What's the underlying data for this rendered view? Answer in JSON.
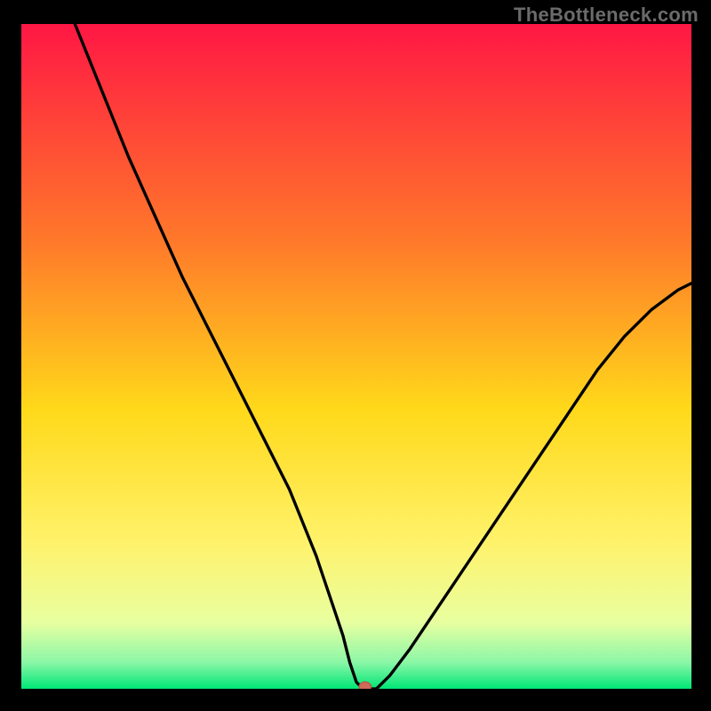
{
  "watermark": "TheBottleneck.com",
  "chart_data": {
    "type": "line",
    "title": "",
    "xlabel": "",
    "ylabel": "",
    "xlim": [
      0,
      100
    ],
    "ylim": [
      0,
      100
    ],
    "series": [
      {
        "name": "curve",
        "x": [
          8,
          12,
          16,
          20,
          24,
          28,
          32,
          36,
          40,
          44,
          46,
          48,
          49,
          50,
          51,
          52,
          53,
          55,
          58,
          62,
          66,
          70,
          74,
          78,
          82,
          86,
          90,
          94,
          98,
          100
        ],
        "y": [
          100,
          90,
          80,
          71,
          62,
          54,
          46,
          38,
          30,
          20,
          14,
          8,
          4,
          1,
          0,
          0,
          0,
          2,
          6,
          12,
          18,
          24,
          30,
          36,
          42,
          48,
          53,
          57,
          60,
          61
        ]
      }
    ],
    "marker": {
      "x": 51.3,
      "y": 0.3
    },
    "gradient_stops": [
      {
        "offset": 0,
        "color": "#ff1744"
      },
      {
        "offset": 33,
        "color": "#ff7a2a"
      },
      {
        "offset": 58,
        "color": "#ffd91a"
      },
      {
        "offset": 78,
        "color": "#fff26b"
      },
      {
        "offset": 90,
        "color": "#e8ffa0"
      },
      {
        "offset": 96,
        "color": "#8cf7a7"
      },
      {
        "offset": 100,
        "color": "#00e676"
      }
    ]
  }
}
